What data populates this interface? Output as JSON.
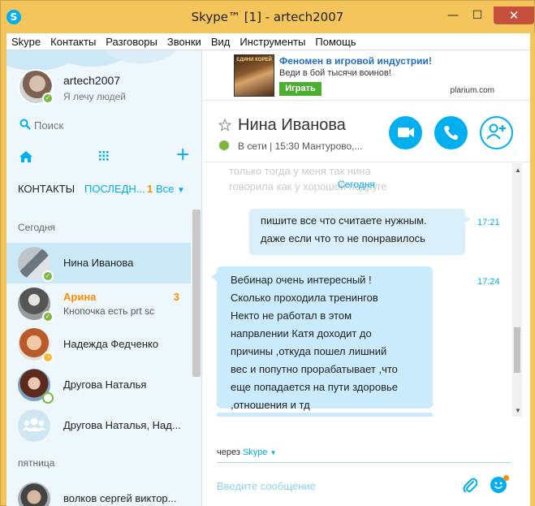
{
  "window": {
    "title": "Skype™ [1] - artech2007",
    "app_icon": "S",
    "min_label": "—",
    "max_label": "☐",
    "close_label": "✕",
    "accent": "#00aff0",
    "frame_color": "#f3c55b"
  },
  "menu": [
    "Skype",
    "Контакты",
    "Разговоры",
    "Звонки",
    "Вид",
    "Инструменты",
    "Помощь"
  ],
  "profile": {
    "name": "artech2007",
    "mood": "Я лечу людей",
    "status": "online"
  },
  "search": {
    "placeholder": "Поиск"
  },
  "tabs": {
    "contacts": "КОНТАКТЫ",
    "recent": "ПОСЛЕДН...",
    "recent_count": "1",
    "filter": "Все"
  },
  "sections": {
    "today": "Сегодня",
    "friday": "пятница"
  },
  "contacts": [
    {
      "name": "Нина Иванова",
      "sub": "",
      "count": "",
      "status": "online",
      "selected": true
    },
    {
      "name": "Арина",
      "sub": "Кнопочка есть prt sc",
      "count": "3",
      "status": "online",
      "selected": false
    },
    {
      "name": "Надежда Федченко",
      "sub": "",
      "count": "",
      "status": "away",
      "selected": false
    },
    {
      "name": "Другова Наталья",
      "sub": "",
      "count": "",
      "status": "offline",
      "selected": false
    },
    {
      "name": "Другова Наталья, Над...",
      "sub": "",
      "count": "",
      "status": "group",
      "selected": false
    },
    {
      "name": "волков сергей виктор...",
      "sub": "",
      "count": "",
      "status": "online",
      "selected": false
    }
  ],
  "ad": {
    "title": "Феномен в игровой индустрии!",
    "subtitle": "Веди в бой тысячи воинов!",
    "button": "Играть",
    "domain": "plarium.com",
    "image_label": "ЕДИНИ КОРЕЙ"
  },
  "chat": {
    "title": "Нина Иванова",
    "status": "В сети",
    "status_detail": "15:30 Мантурово,...",
    "separator": "|",
    "old_text_1": "только тогда у меня так нина",
    "old_text_2": "говорила как у хорошей подруге",
    "day_label": "Сегодня",
    "messages": [
      {
        "dir": "out",
        "time": "17:21",
        "lines": [
          "пишите все что считаете нужным.",
          "даже если что то не понравилось"
        ]
      },
      {
        "dir": "in",
        "time": "17:24",
        "lines": [
          "Вебинар очень интересный !",
          "Сколько проходила тренингов",
          "Некто не работал в этом",
          "напрвлении Катя доходит до",
          "причины  ,откуда пошел лишний",
          "вес и попутно прорабатывает ,что",
          "еще попадается на пути здоровье",
          ",отношения  и тд"
        ]
      }
    ]
  },
  "composer": {
    "via_prefix": "через",
    "via_service": "Skype",
    "placeholder": "Введите сообщение"
  }
}
